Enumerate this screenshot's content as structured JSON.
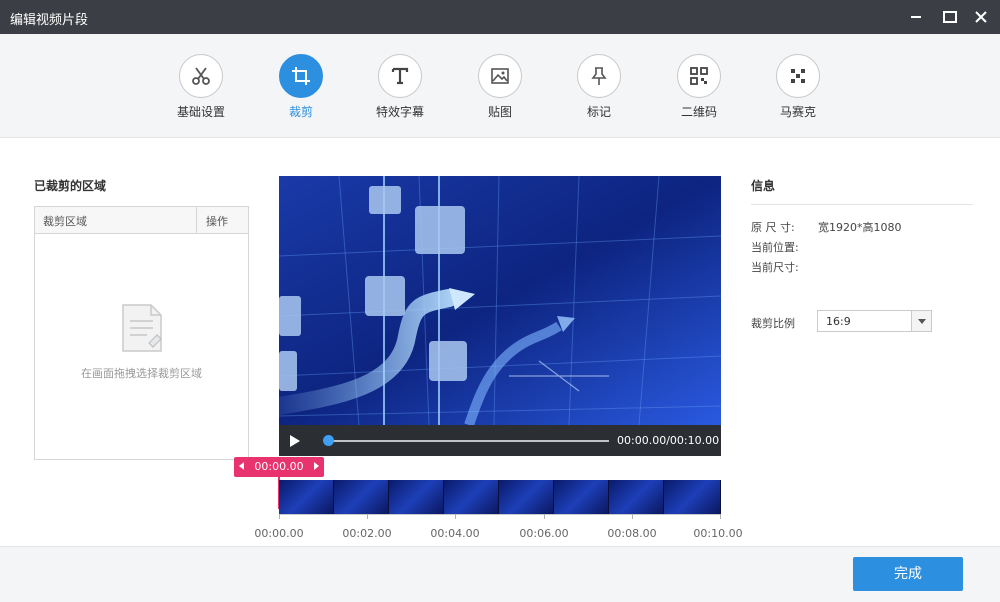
{
  "window": {
    "title": "编辑视频片段"
  },
  "toolbar": {
    "items": [
      {
        "label": "基础设置",
        "icon": "scissors-icon"
      },
      {
        "label": "裁剪",
        "icon": "crop-icon",
        "active": true
      },
      {
        "label": "特效字幕",
        "icon": "text-icon"
      },
      {
        "label": "贴图",
        "icon": "image-icon"
      },
      {
        "label": "标记",
        "icon": "pin-icon"
      },
      {
        "label": "二维码",
        "icon": "qrcode-icon"
      },
      {
        "label": "马赛克",
        "icon": "mosaic-icon"
      }
    ],
    "accent": "#2c8fe0"
  },
  "left": {
    "title": "已裁剪的区域",
    "table": {
      "col_area": "裁剪区域",
      "col_action": "操作"
    },
    "empty_hint": "在画面拖拽选择裁剪区域"
  },
  "player": {
    "timecode": "00:00.00/00:10.00",
    "progress": 0.0
  },
  "timeline": {
    "marker_time": "00:00.00",
    "ticks": [
      "00:00.00",
      "00:02.00",
      "00:04.00",
      "00:06.00",
      "00:08.00",
      "00:10.00"
    ],
    "marker_color": "#e8336e"
  },
  "info": {
    "title": "信息",
    "original_size_label": "原 尺 寸:",
    "original_size_value": "宽1920*高1080",
    "current_pos_label": "当前位置:",
    "current_size_label": "当前尺寸:",
    "ratio_label": "裁剪比例",
    "ratio_value": "16:9"
  },
  "footer": {
    "done_label": "完成"
  }
}
